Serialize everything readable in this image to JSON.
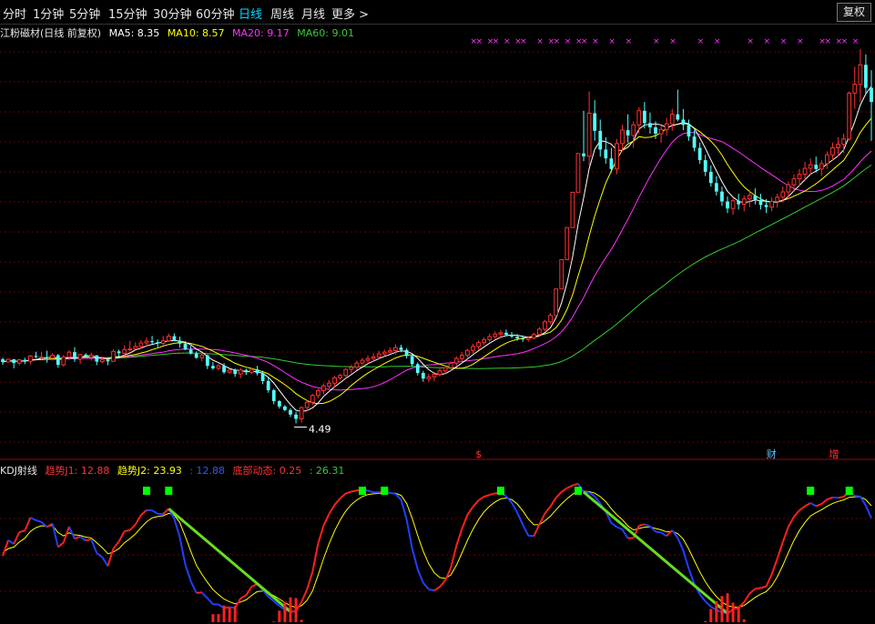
{
  "toolbar": {
    "tabs": [
      {
        "label": "分时"
      },
      {
        "label": "1分钟"
      },
      {
        "label": "5分钟"
      },
      {
        "label": "15分钟"
      },
      {
        "label": "30分钟"
      },
      {
        "label": "60分钟"
      },
      {
        "label": "日线"
      },
      {
        "label": "周线"
      },
      {
        "label": "月线"
      },
      {
        "label": "更多 >"
      }
    ],
    "active_tab": "日线",
    "restore_label": "复权"
  },
  "main_legend": {
    "title": "江粉磁材(日线 前复权)",
    "ma5": "MA5: 8.35",
    "ma10": "MA10: 8.57",
    "ma20": "MA20: 9.17",
    "ma60": "MA60: 9.01",
    "colors": {
      "title": "#e6e6e6",
      "ma5": "#ffffff",
      "ma10": "#ffff00",
      "ma20": "#ff33ff",
      "ma60": "#33cc33"
    }
  },
  "kdj_legend": {
    "title": "KDJ射线",
    "j1": "趋势J1: 12.88",
    "j2": "趋势J2: 23.93",
    "j3": ": 12.88",
    "bottom": "底部动态: 0.25",
    "bottom2": ": 26.31",
    "colors": {
      "title": "#e6e6e6",
      "j1": "#ff3333",
      "j2": "#ffff00",
      "j3": "#3355ff",
      "bottom": "#ff3333",
      "bottom2": "#33cc33"
    }
  },
  "chart_data": {
    "type": "candlestick",
    "price_range": [
      3.6,
      15.2
    ],
    "low_marker_label": "4.49",
    "event_markers": [
      "$",
      "财",
      "增"
    ],
    "x_marker_text": "×",
    "indicator": {
      "type": "kdj",
      "name": "KDJ射线",
      "range": [
        0,
        100
      ]
    },
    "candles": [
      [
        6.31,
        6.35,
        6.15,
        6.23
      ],
      [
        6.23,
        6.31,
        6.23,
        6.31
      ],
      [
        6.31,
        6.31,
        6.05,
        6.2
      ],
      [
        6.2,
        6.32,
        6.14,
        6.29
      ],
      [
        6.29,
        6.35,
        6.17,
        6.25
      ],
      [
        6.25,
        6.43,
        6.16,
        6.4
      ],
      [
        6.4,
        6.52,
        6.34,
        6.37
      ],
      [
        6.37,
        6.51,
        6.3,
        6.37
      ],
      [
        6.37,
        6.55,
        6.21,
        6.35
      ],
      [
        6.35,
        6.48,
        6.27,
        6.42
      ],
      [
        6.42,
        6.46,
        6.07,
        6.15
      ],
      [
        6.15,
        6.43,
        6.1,
        6.37
      ],
      [
        6.37,
        6.56,
        6.28,
        6.51
      ],
      [
        6.51,
        6.65,
        6.23,
        6.31
      ],
      [
        6.31,
        6.46,
        6.18,
        6.44
      ],
      [
        6.44,
        6.48,
        6.36,
        6.37
      ],
      [
        6.37,
        6.49,
        6.27,
        6.42
      ],
      [
        6.42,
        6.42,
        6.14,
        6.24
      ],
      [
        6.24,
        6.38,
        6.2,
        6.3
      ],
      [
        6.3,
        6.37,
        6.14,
        6.25
      ],
      [
        6.25,
        6.59,
        6.23,
        6.53
      ],
      [
        6.53,
        6.58,
        6.39,
        6.48
      ],
      [
        6.48,
        6.7,
        6.4,
        6.58
      ],
      [
        6.58,
        6.83,
        6.53,
        6.6
      ],
      [
        6.6,
        6.79,
        6.6,
        6.67
      ],
      [
        6.67,
        6.85,
        6.61,
        6.77
      ],
      [
        6.77,
        6.93,
        6.67,
        6.82
      ],
      [
        6.82,
        6.97,
        6.71,
        6.79
      ],
      [
        6.79,
        6.87,
        6.64,
        6.76
      ],
      [
        6.76,
        6.97,
        6.71,
        6.83
      ],
      [
        6.83,
        7.04,
        6.8,
        6.96
      ],
      [
        6.96,
        7.04,
        6.82,
        6.83
      ],
      [
        6.83,
        6.95,
        6.64,
        6.75
      ],
      [
        6.75,
        6.82,
        6.57,
        6.58
      ],
      [
        6.58,
        6.69,
        6.44,
        6.47
      ],
      [
        6.47,
        6.53,
        6.32,
        6.35
      ],
      [
        6.35,
        6.5,
        6.25,
        6.42
      ],
      [
        6.42,
        6.44,
        6.03,
        6.12
      ],
      [
        6.12,
        6.23,
        6.01,
        6.05
      ],
      [
        6.05,
        6.18,
        5.99,
        6.12
      ],
      [
        6.12,
        6.2,
        5.89,
        5.94
      ],
      [
        5.94,
        6.04,
        5.89,
        6.0
      ],
      [
        6.0,
        6.05,
        5.81,
        5.89
      ],
      [
        5.89,
        6.06,
        5.77,
        6.0
      ],
      [
        6.0,
        6.04,
        5.86,
        5.94
      ],
      [
        5.94,
        6.06,
        5.89,
        6.02
      ],
      [
        6.02,
        6.12,
        5.85,
        5.91
      ],
      [
        5.91,
        5.98,
        5.6,
        5.69
      ],
      [
        5.69,
        5.79,
        5.36,
        5.43
      ],
      [
        5.43,
        5.47,
        5.03,
        5.12
      ],
      [
        5.12,
        5.15,
        4.91,
        4.97
      ],
      [
        4.97,
        5.01,
        4.83,
        4.87
      ],
      [
        4.87,
        4.92,
        4.67,
        4.74
      ],
      [
        4.74,
        4.82,
        4.49,
        4.62
      ],
      [
        4.62,
        4.97,
        4.51,
        4.94
      ],
      [
        4.94,
        5.15,
        4.83,
        5.09
      ],
      [
        5.09,
        5.33,
        5.01,
        5.28
      ],
      [
        5.28,
        5.47,
        5.2,
        5.42
      ],
      [
        5.42,
        5.62,
        5.31,
        5.55
      ],
      [
        5.55,
        5.72,
        5.48,
        5.63
      ],
      [
        5.63,
        5.84,
        5.5,
        5.78
      ],
      [
        5.78,
        5.9,
        5.71,
        5.85
      ],
      [
        5.85,
        6.06,
        5.74,
        6.02
      ],
      [
        6.02,
        6.15,
        5.91,
        6.08
      ],
      [
        6.08,
        6.27,
        6.0,
        6.2
      ],
      [
        6.2,
        6.35,
        6.13,
        6.28
      ],
      [
        6.28,
        6.42,
        6.18,
        6.33
      ],
      [
        6.33,
        6.48,
        6.23,
        6.37
      ],
      [
        6.37,
        6.55,
        6.29,
        6.46
      ],
      [
        6.46,
        6.58,
        6.4,
        6.51
      ],
      [
        6.51,
        6.64,
        6.47,
        6.55
      ],
      [
        6.55,
        6.73,
        6.44,
        6.64
      ],
      [
        6.64,
        6.72,
        6.51,
        6.57
      ],
      [
        6.57,
        6.62,
        6.33,
        6.4
      ],
      [
        6.4,
        6.45,
        6.1,
        6.17
      ],
      [
        6.17,
        6.22,
        5.85,
        5.92
      ],
      [
        5.92,
        5.98,
        5.67,
        5.76
      ],
      [
        5.76,
        5.9,
        5.66,
        5.81
      ],
      [
        5.81,
        5.95,
        5.69,
        5.88
      ],
      [
        5.88,
        6.05,
        5.82,
        5.98
      ],
      [
        5.98,
        6.12,
        5.88,
        6.07
      ],
      [
        6.07,
        6.25,
        5.98,
        6.2
      ],
      [
        6.2,
        6.39,
        6.1,
        6.33
      ],
      [
        6.33,
        6.51,
        6.23,
        6.42
      ],
      [
        6.42,
        6.6,
        6.35,
        6.56
      ],
      [
        6.56,
        6.75,
        6.47,
        6.67
      ],
      [
        6.67,
        6.84,
        6.57,
        6.78
      ],
      [
        6.78,
        6.93,
        6.71,
        6.86
      ],
      [
        6.86,
        7.04,
        6.8,
        6.95
      ],
      [
        6.95,
        7.1,
        6.88,
        7.02
      ],
      [
        7.02,
        7.14,
        6.93,
        7.06
      ],
      [
        7.06,
        7.15,
        6.96,
        7.0
      ],
      [
        7.0,
        7.08,
        6.91,
        6.95
      ],
      [
        6.95,
        7.02,
        6.83,
        6.9
      ],
      [
        6.9,
        6.98,
        6.8,
        6.87
      ],
      [
        6.87,
        6.96,
        6.81,
        6.91
      ],
      [
        6.91,
        7.06,
        6.86,
        7.01
      ],
      [
        7.01,
        7.22,
        6.97,
        7.16
      ],
      [
        7.16,
        7.42,
        7.1,
        7.37
      ],
      [
        7.37,
        7.62,
        7.3,
        7.55
      ],
      [
        7.55,
        8.3,
        7.55,
        8.3
      ],
      [
        8.3,
        9.13,
        8.3,
        9.13
      ],
      [
        9.13,
        10.04,
        9.13,
        10.04
      ],
      [
        10.04,
        11.04,
        10.04,
        11.04
      ],
      [
        11.04,
        12.14,
        11.04,
        12.14
      ],
      [
        12.14,
        13.35,
        11.92,
        12.06
      ],
      [
        12.06,
        13.9,
        11.8,
        13.28
      ],
      [
        13.28,
        13.65,
        12.5,
        12.78
      ],
      [
        12.78,
        13.1,
        12.05,
        12.25
      ],
      [
        12.25,
        12.6,
        11.85,
        12.0
      ],
      [
        12.0,
        12.3,
        11.6,
        11.7
      ],
      [
        11.7,
        12.55,
        11.55,
        12.42
      ],
      [
        12.42,
        12.95,
        12.2,
        12.8
      ],
      [
        12.8,
        13.25,
        12.45,
        12.65
      ],
      [
        12.65,
        13.05,
        12.3,
        12.95
      ],
      [
        12.95,
        13.45,
        12.7,
        13.35
      ],
      [
        13.35,
        13.6,
        12.85,
        13.0
      ],
      [
        13.0,
        13.3,
        12.7,
        12.88
      ],
      [
        12.88,
        13.05,
        12.55,
        12.7
      ],
      [
        12.7,
        12.95,
        12.45,
        12.82
      ],
      [
        12.82,
        13.15,
        12.65,
        12.98
      ],
      [
        12.98,
        13.4,
        12.78,
        13.25
      ],
      [
        13.25,
        13.95,
        13.05,
        13.1
      ],
      [
        13.1,
        13.4,
        12.8,
        12.95
      ],
      [
        12.95,
        13.1,
        12.5,
        12.62
      ],
      [
        12.62,
        12.8,
        12.2,
        12.3
      ],
      [
        12.3,
        12.45,
        11.85,
        11.95
      ],
      [
        11.95,
        12.1,
        11.5,
        11.62
      ],
      [
        11.62,
        11.8,
        11.2,
        11.3
      ],
      [
        11.3,
        11.5,
        10.95,
        11.06
      ],
      [
        11.06,
        11.2,
        10.65,
        10.78
      ],
      [
        10.78,
        10.92,
        10.45,
        10.58
      ],
      [
        10.58,
        10.9,
        10.4,
        10.8
      ],
      [
        10.8,
        11.0,
        10.55,
        10.7
      ],
      [
        10.7,
        10.95,
        10.5,
        10.85
      ],
      [
        10.85,
        11.1,
        10.62,
        10.95
      ],
      [
        10.95,
        11.15,
        10.7,
        10.82
      ],
      [
        10.82,
        11.0,
        10.55,
        10.68
      ],
      [
        10.68,
        10.85,
        10.45,
        10.62
      ],
      [
        10.62,
        10.9,
        10.5,
        10.78
      ],
      [
        10.78,
        11.0,
        10.6,
        10.9
      ],
      [
        10.9,
        11.2,
        10.75,
        11.05
      ],
      [
        11.05,
        11.35,
        10.85,
        11.25
      ],
      [
        11.25,
        11.55,
        11.05,
        11.42
      ],
      [
        11.42,
        11.7,
        11.2,
        11.55
      ],
      [
        11.55,
        11.9,
        11.35,
        11.72
      ],
      [
        11.72,
        12.0,
        11.55,
        11.82
      ],
      [
        11.82,
        12.05,
        11.6,
        11.7
      ],
      [
        11.7,
        11.95,
        11.5,
        11.85
      ],
      [
        11.85,
        12.2,
        11.7,
        12.1
      ],
      [
        12.1,
        12.45,
        11.95,
        12.3
      ],
      [
        12.3,
        12.6,
        12.05,
        12.4
      ],
      [
        12.4,
        12.7,
        12.15,
        12.55
      ],
      [
        12.55,
        13.9,
        12.5,
        13.85
      ],
      [
        13.85,
        14.6,
        13.4,
        14.1
      ],
      [
        14.1,
        15.1,
        13.6,
        14.65
      ],
      [
        14.65,
        14.95,
        13.8,
        14.0
      ],
      [
        14.0,
        14.5,
        12.5,
        13.6
      ]
    ]
  }
}
